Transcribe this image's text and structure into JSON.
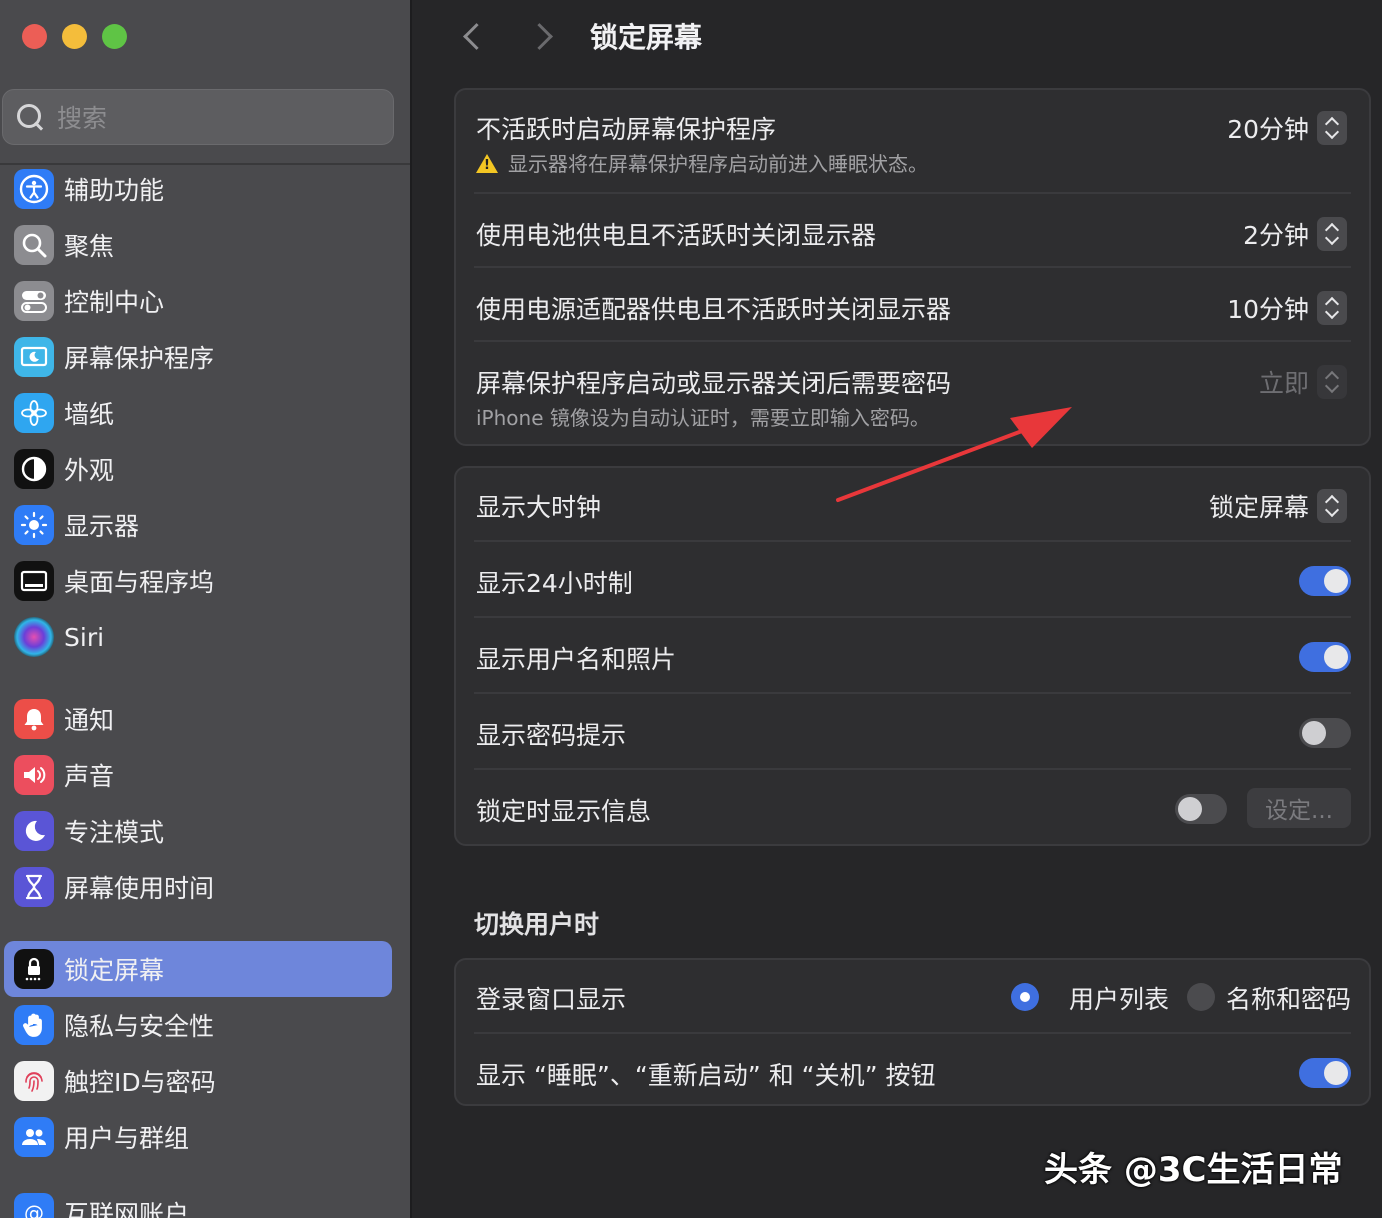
{
  "sidebar": {
    "search_placeholder": "搜索",
    "items": [
      {
        "label": "辅助功能",
        "icon": "accessibility-icon",
        "color": "#2f7cf6"
      },
      {
        "label": "聚焦",
        "icon": "spotlight-icon",
        "color": "#8c8c90"
      },
      {
        "label": "控制中心",
        "icon": "control-center-icon",
        "color": "#8c8c90"
      },
      {
        "label": "屏幕保护程序",
        "icon": "screensaver-icon",
        "color": "#3fb6e8"
      },
      {
        "label": "墙纸",
        "icon": "wallpaper-icon",
        "color": "#2fa6f0"
      },
      {
        "label": "外观",
        "icon": "appearance-icon",
        "color": "#111111"
      },
      {
        "label": "显示器",
        "icon": "display-icon",
        "color": "#2f7cf6"
      },
      {
        "label": "桌面与程序坞",
        "icon": "dock-icon",
        "color": "#111111"
      },
      {
        "label": "Siri",
        "icon": "siri-icon",
        "color": "#222222"
      },
      {
        "label": "通知",
        "icon": "notifications-icon",
        "color": "#ec4e48"
      },
      {
        "label": "声音",
        "icon": "sound-icon",
        "color": "#ec4e5e"
      },
      {
        "label": "专注模式",
        "icon": "focus-moon-icon",
        "color": "#5a55d6"
      },
      {
        "label": "屏幕使用时间",
        "icon": "screen-time-icon",
        "color": "#5a55d6"
      },
      {
        "label": "锁定屏幕",
        "icon": "lock-screen-icon",
        "color": "#111111"
      },
      {
        "label": "隐私与安全性",
        "icon": "privacy-hand-icon",
        "color": "#2f7cf6"
      },
      {
        "label": "触控ID与密码",
        "icon": "fingerprint-icon",
        "color": "#f2f2f2"
      },
      {
        "label": "用户与群组",
        "icon": "users-icon",
        "color": "#2f7cf6"
      },
      {
        "label": "互联网账户",
        "icon": "internet-accounts-icon",
        "color": "#2f7cf6"
      }
    ],
    "active_index": 13
  },
  "header": {
    "title": "锁定屏幕"
  },
  "panel1": {
    "rows": [
      {
        "label": "不活跃时启动屏幕保护程序",
        "sub": "显示器将在屏幕保护程序启动前进入睡眠状态。",
        "value": "20分钟"
      },
      {
        "label": "使用电池供电且不活跃时关闭显示器",
        "value": "2分钟"
      },
      {
        "label": "使用电源适配器供电且不活跃时关闭显示器",
        "value": "10分钟"
      },
      {
        "label": "屏幕保护程序启动或显示器关闭后需要密码",
        "sub": "iPhone 镜像设为自动认证时，需要立即输入密码。",
        "value": "立即"
      }
    ]
  },
  "panel2": {
    "rows": [
      {
        "label": "显示大时钟",
        "value": "锁定屏幕"
      },
      {
        "label": "显示24小时制",
        "on": true
      },
      {
        "label": "显示用户名和照片",
        "on": true
      },
      {
        "label": "显示密码提示",
        "on": false
      },
      {
        "label": "锁定时显示信息",
        "on": false,
        "button": "设定..."
      }
    ]
  },
  "switch_section": {
    "title": "切换用户时"
  },
  "panel3": {
    "rows": [
      {
        "label": "登录窗口显示",
        "options": [
          "用户列表",
          "名称和密码"
        ],
        "selected": 0
      },
      {
        "label": "显示 “睡眠”、“重新启动” 和 “关机” 按钮",
        "on": true
      }
    ]
  },
  "watermark": {
    "text": "头条 @3C生活日常"
  },
  "colors": {
    "accent": "#3f6fe0",
    "selection": "#6e86db",
    "arrow": "#e8373a"
  }
}
